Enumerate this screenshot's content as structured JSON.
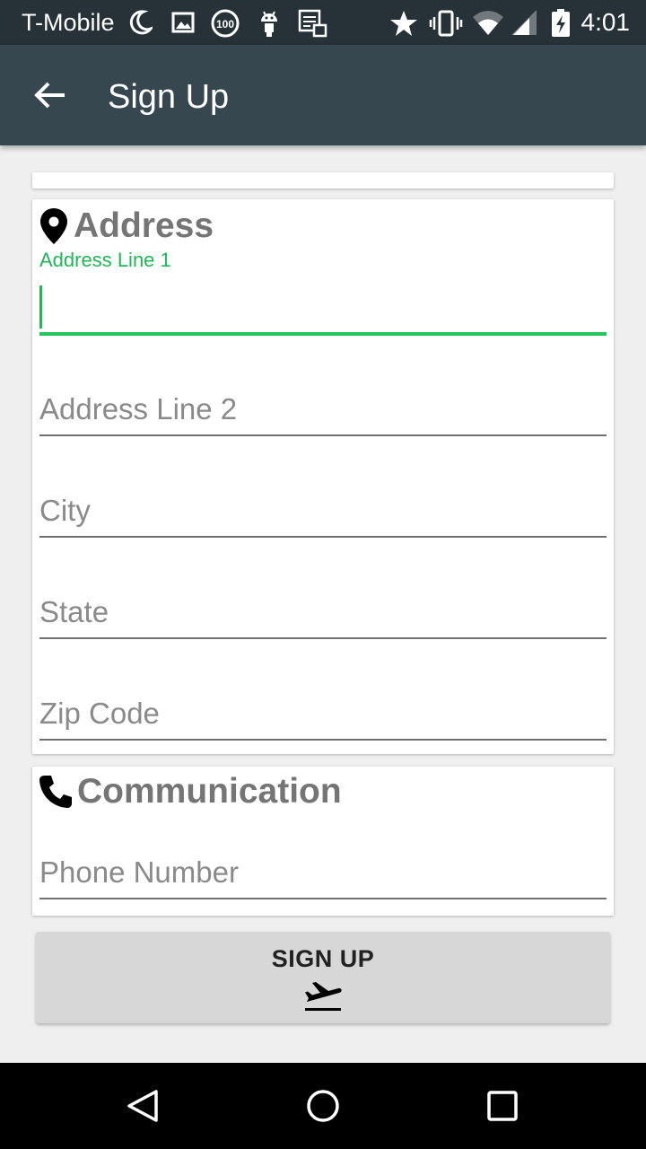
{
  "status_bar": {
    "carrier": "T-Mobile",
    "time": "4:01",
    "icons": [
      "moon-icon",
      "image-icon",
      "battery-100-icon",
      "android-icon",
      "screenshot-icon",
      "star-icon",
      "vibrate-icon",
      "wifi-icon",
      "signal-icon",
      "battery-charging-icon"
    ]
  },
  "app_bar": {
    "title": "Sign Up",
    "back_icon": "arrow-back-icon"
  },
  "address_section": {
    "title": "Address",
    "icon": "location-pin-icon",
    "fields": [
      {
        "label": "Address Line 1",
        "value": "",
        "focused": true
      },
      {
        "label": "Address Line 2",
        "value": ""
      },
      {
        "label": "City",
        "value": ""
      },
      {
        "label": "State",
        "value": ""
      },
      {
        "label": "Zip Code",
        "value": ""
      }
    ]
  },
  "communication_section": {
    "title": "Communication",
    "icon": "phone-icon",
    "fields": [
      {
        "label": "Phone Number",
        "value": ""
      }
    ]
  },
  "signup_button": {
    "label": "SIGN UP",
    "icon": "flight-takeoff-icon"
  },
  "colors": {
    "status_bar": "#263238",
    "app_bar": "#37474f",
    "accent": "#22c55e"
  }
}
